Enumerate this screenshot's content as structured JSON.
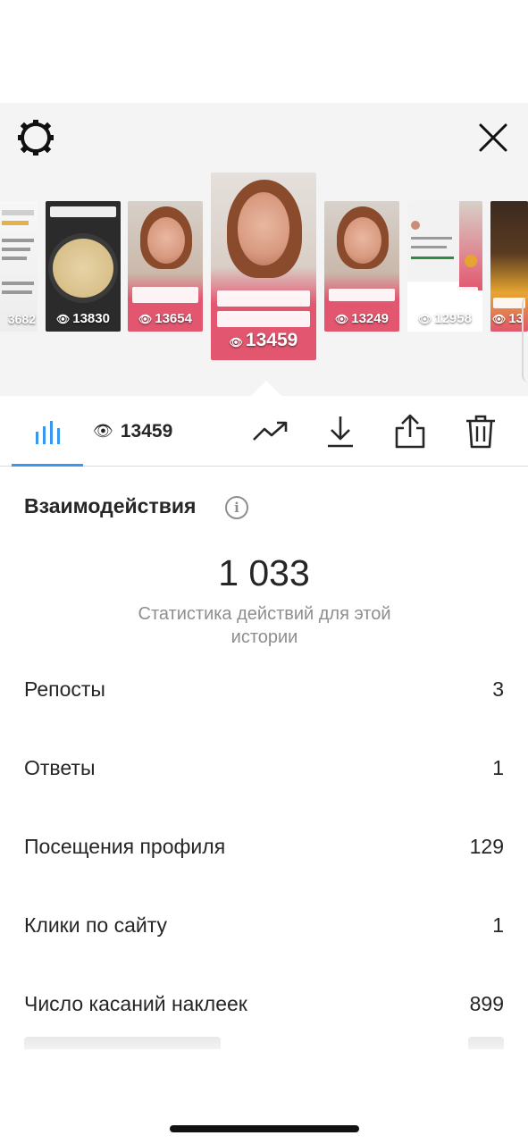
{
  "header": {
    "settings_icon": "gear-icon",
    "close_icon": "close-icon"
  },
  "stories": [
    {
      "views": "3682",
      "theme": "chat"
    },
    {
      "views": "13830",
      "theme": "pancake"
    },
    {
      "views": "13654",
      "theme": "selfie"
    },
    {
      "views": "13459",
      "theme": "selfie",
      "selected": true
    },
    {
      "views": "13249",
      "theme": "selfie"
    },
    {
      "views": "12958",
      "theme": "screenshot"
    },
    {
      "views": "13",
      "theme": "selfie"
    }
  ],
  "toolbar": {
    "stats_tab_icon": "bar-chart-icon",
    "views_count": "13459",
    "views_icon": "eye-icon",
    "promote_icon": "trending-icon",
    "download_icon": "download-icon",
    "share_icon": "share-icon",
    "delete_icon": "trash-icon"
  },
  "interactions": {
    "title": "Взаимодействия",
    "info_icon": "i",
    "total": "1 033",
    "subtitle": "Статистика действий для этой истории",
    "rows": [
      {
        "label": "Репосты",
        "value": "3"
      },
      {
        "label": "Ответы",
        "value": "1"
      },
      {
        "label": "Посещения профиля",
        "value": "129"
      },
      {
        "label": "Клики по сайту",
        "value": "1"
      },
      {
        "label": "Число касаний наклеек",
        "value": "899"
      }
    ]
  },
  "colors": {
    "accent": "#3897f0",
    "header_bg": "#f4f4f4",
    "pink": "#e2576f"
  }
}
